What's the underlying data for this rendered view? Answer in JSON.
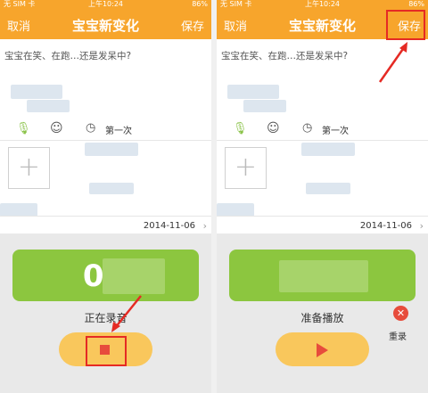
{
  "accent_color": "#f7a52c",
  "status_bar": {
    "carrier": "无 SIM 卡",
    "time": "上午10:24",
    "battery": "86%"
  },
  "nav": {
    "cancel_label": "取消",
    "title": "宝宝新变化",
    "save_label": "保存"
  },
  "composer": {
    "placeholder": "宝宝在笑、在跑…还是发呆中?",
    "first_time_label": "第一次",
    "date": "2014-11-06"
  },
  "left_panel": {
    "status_text": "正在录音",
    "timer": "00",
    "primary_icon": "stop-icon"
  },
  "right_panel": {
    "status_text": "准备播放",
    "redo_label": "重录",
    "primary_icon": "play-icon"
  }
}
